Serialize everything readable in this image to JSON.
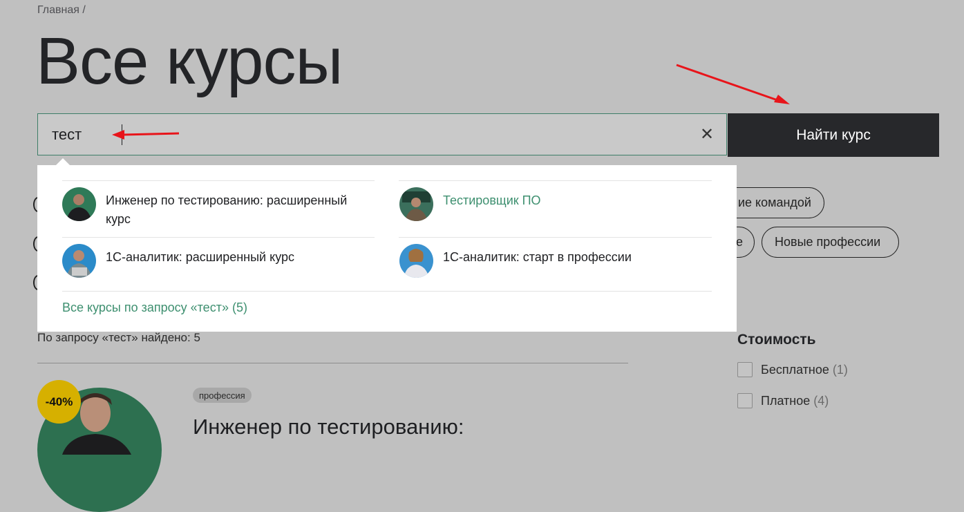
{
  "breadcrumb": "Главная /",
  "page_title": "Все курсы",
  "search": {
    "value": "тест",
    "clear_icon": "close-icon",
    "button_label": "Найти курс"
  },
  "suggestions": [
    {
      "label": "Инженер по тестированию: расширенный курс",
      "highlighted": false
    },
    {
      "label": "Тестировщик ПО",
      "highlighted": true
    },
    {
      "label": "1С-аналитик: расширенный курс",
      "highlighted": false
    },
    {
      "label": "1С-аналитик: старт в профессии",
      "highlighted": false
    }
  ],
  "all_results_link": "Все курсы по запросу «тест» (5)",
  "filter_pills": [
    "ие командой",
    "е",
    "Новые профессии"
  ],
  "results_count": "По запросу «тест» найдено: 5",
  "filters": {
    "title": "Стоимость",
    "options": [
      {
        "label": "Бесплатное",
        "count": "(1)"
      },
      {
        "label": "Платное",
        "count": "(4)"
      }
    ]
  },
  "course": {
    "discount": "-40%",
    "tag": "профессия",
    "title": "Инженер по тестированию:"
  },
  "colors": {
    "accent_green": "#3d8f6f",
    "button_dark": "#27282b",
    "discount_yellow": "#d6b000",
    "annotation_arrow": "#e8141a"
  }
}
